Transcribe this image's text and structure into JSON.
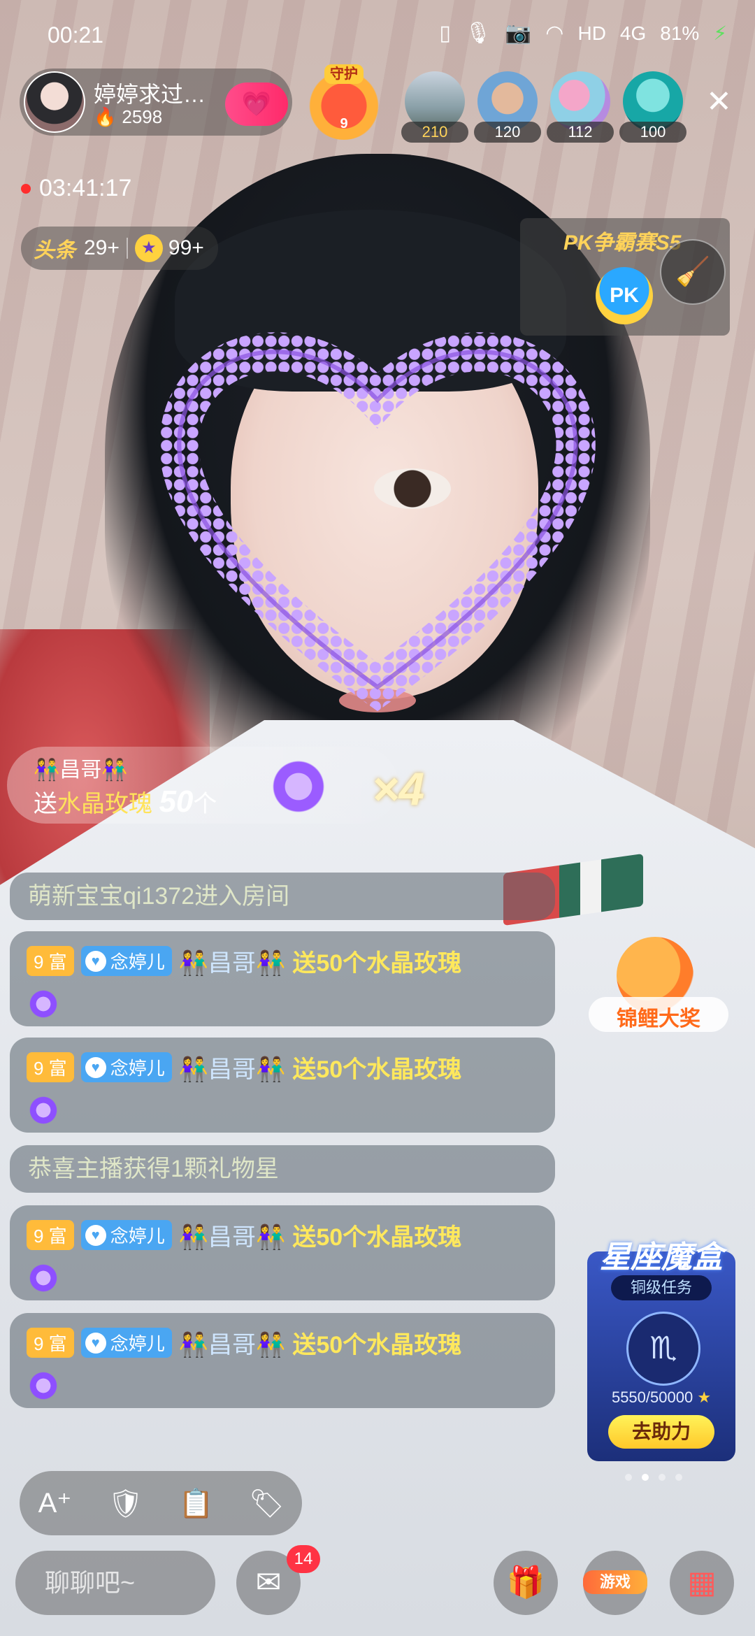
{
  "status_bar": {
    "time": "00:21",
    "network": "HD",
    "signal": "4G",
    "battery": "81%"
  },
  "host": {
    "name": "婷婷求过…",
    "popularity": "2598"
  },
  "guard": {
    "tag": "守护",
    "count": "9"
  },
  "viewers": [
    {
      "count": "210"
    },
    {
      "count": "120"
    },
    {
      "count": "112"
    },
    {
      "count": "100"
    }
  ],
  "live": {
    "duration": "03:41:17"
  },
  "rank": {
    "headline_label": "头条",
    "headline_count": "29+",
    "star_count": "99+"
  },
  "pk": {
    "title": "PK争霸赛S5",
    "button": "PK"
  },
  "gift_banner": {
    "sender": "👫昌哥👫",
    "prefix": "送",
    "gift_name": "水晶玫瑰",
    "amount": "50",
    "unit": "个",
    "multiplier": "×4"
  },
  "chat": {
    "messages": [
      {
        "type": "system",
        "text": "萌新宝宝qi1372进入房间"
      },
      {
        "type": "gift",
        "level": "9 富",
        "fan_badge": "念婷儿",
        "user": "👫昌哥👫",
        "action": "送50个水晶玫瑰"
      },
      {
        "type": "gift",
        "level": "9 富",
        "fan_badge": "念婷儿",
        "user": "👫昌哥👫",
        "action": "送50个水晶玫瑰"
      },
      {
        "type": "system",
        "text": "恭喜主播获得1颗礼物星"
      },
      {
        "type": "gift",
        "level": "9 富",
        "fan_badge": "念婷儿",
        "user": "👫昌哥👫",
        "action": "送50个水晶玫瑰"
      },
      {
        "type": "gift",
        "level": "9 富",
        "fan_badge": "念婷儿",
        "user": "👫昌哥👫",
        "action": "送50个水晶玫瑰"
      }
    ]
  },
  "koi": {
    "label": "锦鲤大奖"
  },
  "star_box": {
    "title": "星座魔盒",
    "task": "铜级任务",
    "progress": "5550/50000",
    "button": "去助力"
  },
  "carousel": {
    "total": 4,
    "active": 1
  },
  "bottom": {
    "input_placeholder": "聊聊吧~",
    "mail_badge": "14",
    "game_label": "游戏"
  },
  "colors": {
    "accent_pink": "#ff2a6a",
    "gift_yellow": "#ffe85c",
    "level_badge": "#ffbb3a",
    "fan_badge": "#4aa6f2"
  }
}
